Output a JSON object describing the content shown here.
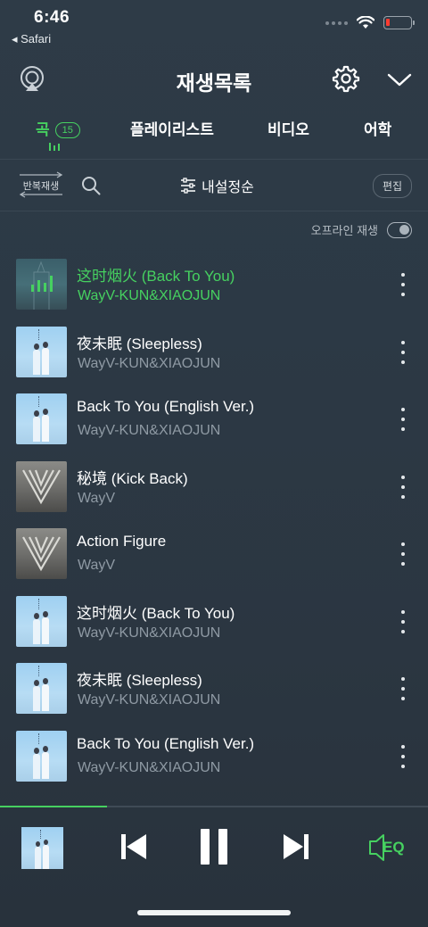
{
  "status_bar": {
    "time": "6:46",
    "back_app": "◂ Safari",
    "battery_level": 0.1
  },
  "header": {
    "title": "재생목록",
    "icons": [
      "airplay-icon",
      "gear-icon",
      "chevron-down-icon"
    ]
  },
  "tabs": [
    {
      "label": "곡",
      "count": "15",
      "active": true
    },
    {
      "label": "플레이리스트",
      "active": false
    },
    {
      "label": "비디오",
      "active": false
    },
    {
      "label": "어학",
      "active": false
    }
  ],
  "toolbar": {
    "repeat_label": "반복재생",
    "sort_label": "내설정순",
    "edit_label": "편집"
  },
  "offline": {
    "label": "오프라인 재생",
    "enabled": false
  },
  "songs": [
    {
      "title": "这时烟火 (Back To You)",
      "artist": "WayV-KUN&XIAOJUN",
      "cover": "playing",
      "playing": true
    },
    {
      "title": "夜未眠 (Sleepless)",
      "artist": "WayV-KUN&XIAOJUN",
      "cover": "blue",
      "playing": false
    },
    {
      "title": "Back To You (English Ver.)",
      "artist": "WayV-KUN&XIAOJUN",
      "cover": "blue",
      "playing": false
    },
    {
      "title": "秘境 (Kick Back)",
      "artist": "WayV",
      "cover": "gray",
      "playing": false
    },
    {
      "title": "Action Figure",
      "artist": "WayV",
      "cover": "gray",
      "playing": false
    },
    {
      "title": "这时烟火 (Back To You)",
      "artist": "WayV-KUN&XIAOJUN",
      "cover": "blue",
      "playing": false
    },
    {
      "title": "夜未眠 (Sleepless)",
      "artist": "WayV-KUN&XIAOJUN",
      "cover": "blue",
      "playing": false
    },
    {
      "title": "Back To You (English Ver.)",
      "artist": "WayV-KUN&XIAOJUN",
      "cover": "blue",
      "playing": false
    }
  ],
  "player": {
    "progress": 0.25,
    "eq_label": "EQ"
  },
  "colors": {
    "accent": "#46d160",
    "background": "#2d3a46",
    "muted_text": "#8f9aa4"
  }
}
